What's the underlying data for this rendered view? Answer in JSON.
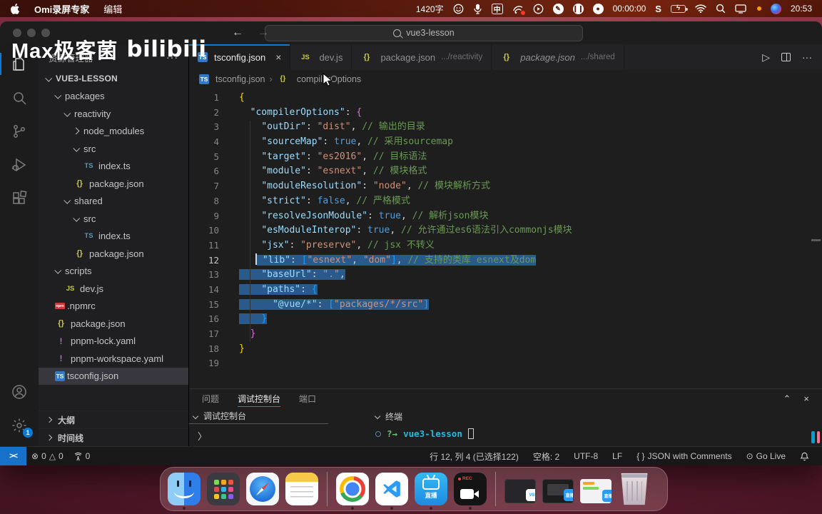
{
  "colors": {
    "accent_blue": "#0a7bd6",
    "selection": "#2a5a8c",
    "bilibili_cyan": "#00a1d6",
    "bilibili_pink": "#fb7299",
    "menu_bg": "#5a1a0f",
    "status_remote": "#1871c9"
  },
  "menu_bar": {
    "app_name": "Omi录屏专家",
    "menu_edit": "编辑",
    "word_count": "1420字",
    "input_method": "中",
    "timer": "00:00:00",
    "sogou": "S",
    "clock": "20:53"
  },
  "watermark": {
    "title": "Max极客菌",
    "logo": "bilibili"
  },
  "window": {
    "command_center": {
      "search_text": "vue3-lesson"
    },
    "sidebar": {
      "header": "资源管理器",
      "more": "···",
      "tree": [
        {
          "label": "VUE3-LESSON",
          "depth": 0,
          "chev": "down",
          "bold": true
        },
        {
          "label": "packages",
          "depth": 1,
          "chev": "down"
        },
        {
          "label": "reactivity",
          "depth": 2,
          "chev": "down"
        },
        {
          "label": "node_modules",
          "depth": 3,
          "chev": "right"
        },
        {
          "label": "src",
          "depth": 3,
          "chev": "down"
        },
        {
          "label": "index.ts",
          "depth": 4,
          "icon": "ts"
        },
        {
          "label": "package.json",
          "depth": 3,
          "icon": "json"
        },
        {
          "label": "shared",
          "depth": 2,
          "chev": "down"
        },
        {
          "label": "src",
          "depth": 3,
          "chev": "down"
        },
        {
          "label": "index.ts",
          "depth": 4,
          "icon": "ts"
        },
        {
          "label": "package.json",
          "depth": 3,
          "icon": "json"
        },
        {
          "label": "scripts",
          "depth": 1,
          "chev": "down"
        },
        {
          "label": "dev.js",
          "depth": 2,
          "icon": "js"
        },
        {
          "label": ".npmrc",
          "depth": 1,
          "icon": "npm"
        },
        {
          "label": "package.json",
          "depth": 1,
          "icon": "json"
        },
        {
          "label": "pnpm-lock.yaml",
          "depth": 1,
          "icon": "excl"
        },
        {
          "label": "pnpm-workspace.yaml",
          "depth": 1,
          "icon": "excl"
        },
        {
          "label": "tsconfig.json",
          "depth": 1,
          "icon": "tsbox",
          "selected": true
        }
      ],
      "sections": [
        {
          "label": "大纲"
        },
        {
          "label": "时间线"
        }
      ]
    },
    "tabs": [
      {
        "icon": "tsbox",
        "label": "tsconfig.json",
        "active": true,
        "close": "×"
      },
      {
        "icon": "js",
        "label": "dev.js"
      },
      {
        "icon": "json",
        "label": "package.json",
        "suffix": ".../reactivity"
      },
      {
        "icon": "json",
        "label": "package.json",
        "suffix": ".../shared",
        "italic": true
      }
    ],
    "editor_actions": {
      "run": "▷",
      "more": "···"
    },
    "breadcrumb": {
      "file": "tsconfig.json",
      "sep": "›",
      "brace": "{}",
      "symbol": "compilerOptions"
    },
    "code": {
      "lines": [
        {
          "n": 1,
          "seg": [
            [
              "b1",
              "{"
            ]
          ]
        },
        {
          "n": 2,
          "seg": [
            [
              "p",
              "  "
            ],
            [
              "k",
              "\"compilerOptions\""
            ],
            [
              "p",
              ": "
            ],
            [
              "b2",
              "{"
            ]
          ]
        },
        {
          "n": 3,
          "seg": [
            [
              "p",
              "    "
            ],
            [
              "k",
              "\"outDir\""
            ],
            [
              "p",
              ": "
            ],
            [
              "s",
              "\"dist\""
            ],
            [
              "p",
              ", "
            ],
            [
              "c",
              "// 输出的目录"
            ]
          ]
        },
        {
          "n": 4,
          "seg": [
            [
              "p",
              "    "
            ],
            [
              "k",
              "\"sourceMap\""
            ],
            [
              "p",
              ": "
            ],
            [
              "w",
              "true"
            ],
            [
              "p",
              ", "
            ],
            [
              "c",
              "// 采用sourcemap"
            ]
          ]
        },
        {
          "n": 5,
          "seg": [
            [
              "p",
              "    "
            ],
            [
              "k",
              "\"target\""
            ],
            [
              "p",
              ": "
            ],
            [
              "s",
              "\"es2016\""
            ],
            [
              "p",
              ", "
            ],
            [
              "c",
              "// 目标语法"
            ]
          ]
        },
        {
          "n": 6,
          "seg": [
            [
              "p",
              "    "
            ],
            [
              "k",
              "\"module\""
            ],
            [
              "p",
              ": "
            ],
            [
              "s",
              "\"esnext\""
            ],
            [
              "p",
              ", "
            ],
            [
              "c",
              "// 模块格式"
            ]
          ]
        },
        {
          "n": 7,
          "seg": [
            [
              "p",
              "    "
            ],
            [
              "k",
              "\"moduleResolution\""
            ],
            [
              "p",
              ": "
            ],
            [
              "s",
              "\"node\""
            ],
            [
              "p",
              ", "
            ],
            [
              "c",
              "// 模块解析方式"
            ]
          ]
        },
        {
          "n": 8,
          "seg": [
            [
              "p",
              "    "
            ],
            [
              "k",
              "\"strict\""
            ],
            [
              "p",
              ": "
            ],
            [
              "w",
              "false"
            ],
            [
              "p",
              ", "
            ],
            [
              "c",
              "// 严格模式"
            ]
          ]
        },
        {
          "n": 9,
          "seg": [
            [
              "p",
              "    "
            ],
            [
              "k",
              "\"resolveJsonModule\""
            ],
            [
              "p",
              ": "
            ],
            [
              "w",
              "true"
            ],
            [
              "p",
              ", "
            ],
            [
              "c",
              "// 解析json模块"
            ]
          ]
        },
        {
          "n": 10,
          "seg": [
            [
              "p",
              "    "
            ],
            [
              "k",
              "\"esModuleInterop\""
            ],
            [
              "p",
              ": "
            ],
            [
              "w",
              "true"
            ],
            [
              "p",
              ", "
            ],
            [
              "c",
              "// 允许通过es6语法引入commonjs模块"
            ]
          ]
        },
        {
          "n": 11,
          "seg": [
            [
              "p",
              "    "
            ],
            [
              "k",
              "\"jsx\""
            ],
            [
              "p",
              ": "
            ],
            [
              "s",
              "\"preserve\""
            ],
            [
              "p",
              ", "
            ],
            [
              "c",
              "// jsx 不转义"
            ]
          ]
        },
        {
          "n": 12,
          "cur": true,
          "sel": "partial",
          "pre": "   ",
          "seg": [
            [
              "p",
              " "
            ],
            [
              "k",
              "\"lib\""
            ],
            [
              "p",
              ": "
            ],
            [
              "b3",
              "["
            ],
            [
              "s",
              "\"esnext\""
            ],
            [
              "p",
              ", "
            ],
            [
              "s",
              "\"dom\""
            ],
            [
              "b3",
              "]"
            ],
            [
              "p",
              ", "
            ],
            [
              "c",
              "// 支持的类库 esnext及dom"
            ]
          ]
        },
        {
          "n": 13,
          "sel": true,
          "seg": [
            [
              "p",
              "    "
            ],
            [
              "k",
              "\"baseUrl\""
            ],
            [
              "p",
              ": "
            ],
            [
              "s",
              "\".\""
            ],
            [
              "p",
              ","
            ]
          ]
        },
        {
          "n": 14,
          "sel": true,
          "seg": [
            [
              "p",
              "    "
            ],
            [
              "k",
              "\"paths\""
            ],
            [
              "p",
              ": "
            ],
            [
              "b3",
              "{"
            ]
          ]
        },
        {
          "n": 15,
          "sel": true,
          "seg": [
            [
              "p",
              "      "
            ],
            [
              "k",
              "\"@vue/*\""
            ],
            [
              "p",
              ": "
            ],
            [
              "b3",
              "["
            ],
            [
              "s",
              "\"packages/*/src\""
            ],
            [
              "b3",
              "]"
            ]
          ]
        },
        {
          "n": 16,
          "sel": true,
          "seg": [
            [
              "p",
              "    "
            ],
            [
              "b3",
              "}"
            ]
          ]
        },
        {
          "n": 17,
          "seg": [
            [
              "p",
              "  "
            ],
            [
              "b2",
              "}"
            ]
          ]
        },
        {
          "n": 18,
          "seg": [
            [
              "b1",
              "}"
            ]
          ]
        },
        {
          "n": 19,
          "seg": []
        }
      ]
    },
    "panel": {
      "tabs": [
        {
          "label": "问题"
        },
        {
          "label": "调试控制台",
          "active": true
        },
        {
          "label": "端口"
        }
      ],
      "collapse": "⌃",
      "close": "×",
      "left_header": "调试控制台",
      "right_header": "终端",
      "debug_prompt": "〉",
      "terminal": {
        "prompt": "?→",
        "cwd": "vue3-lesson"
      }
    },
    "status_bar": {
      "remote": "><",
      "errors": "0",
      "warnings": "0",
      "ports": "0",
      "cursor": "行 12, 列 4 (已选择122)",
      "indent": "空格: 2",
      "encoding": "UTF-8",
      "eol": "LF",
      "lang_brace": "{ }",
      "language": "JSON with Comments",
      "golive_icon": "⊙",
      "golive": "Go Live"
    }
  },
  "dock": {
    "items": [
      {
        "id": "finder",
        "running": true
      },
      {
        "id": "launchpad"
      },
      {
        "id": "safari"
      },
      {
        "id": "notes"
      },
      {
        "id": "divider"
      },
      {
        "id": "chrome",
        "running": true
      },
      {
        "id": "vscode",
        "running": true
      },
      {
        "id": "bilibili-live",
        "label": "直播",
        "running": true
      },
      {
        "id": "screen-recorder",
        "label": "REC",
        "running": true
      },
      {
        "id": "divider"
      },
      {
        "id": "min-window-vscode"
      },
      {
        "id": "min-window-recorder",
        "badge": "直播"
      },
      {
        "id": "min-window-notes",
        "badge": "直播"
      },
      {
        "id": "trash"
      }
    ]
  }
}
